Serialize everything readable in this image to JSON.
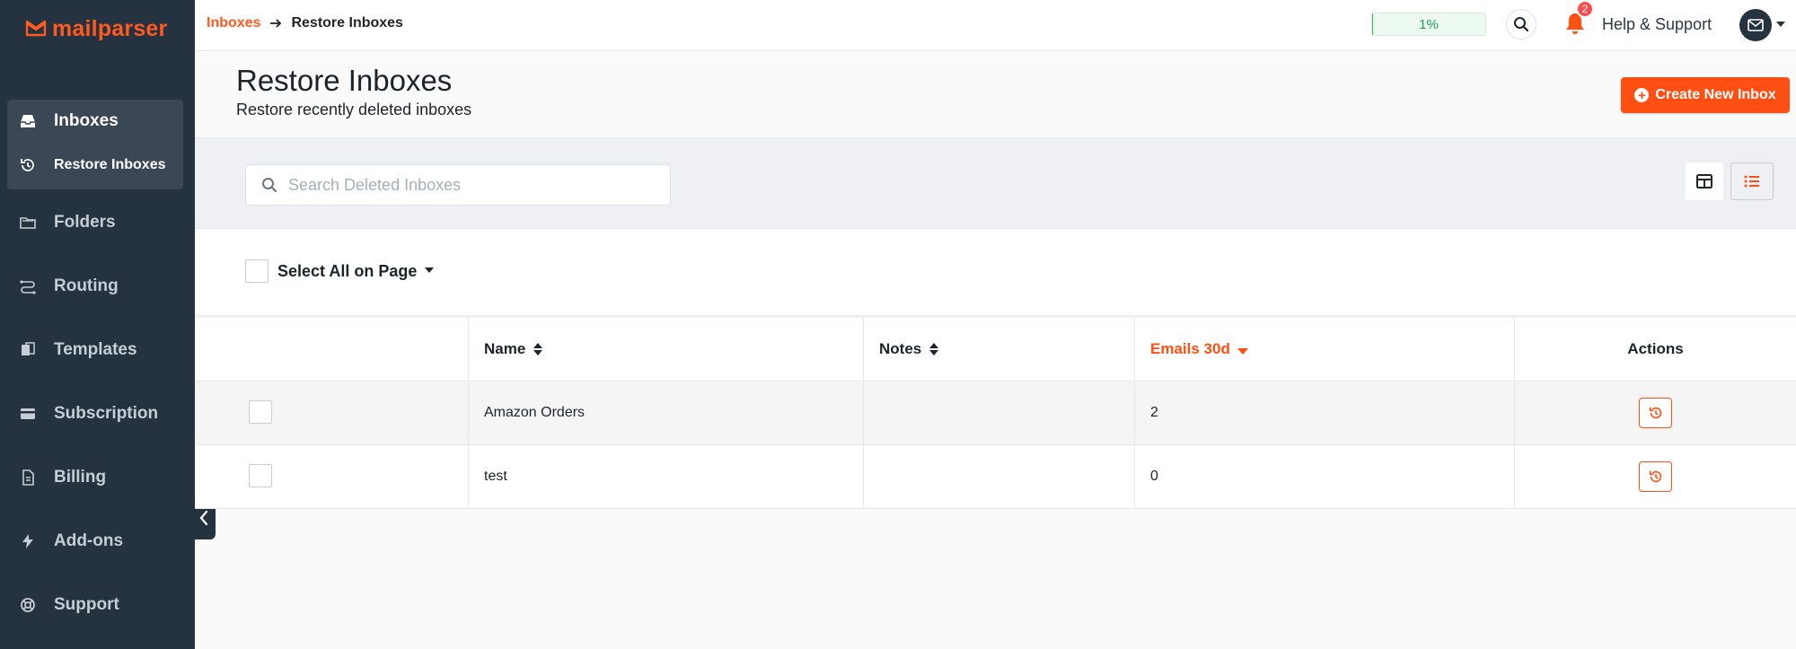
{
  "app": {
    "logo_text": "mailparser",
    "brand_color": "#ff5a1f"
  },
  "breadcrumb": {
    "parent": "Inboxes",
    "current": "Restore Inboxes"
  },
  "topbar": {
    "usage_percent": 1,
    "usage_label": "1%",
    "notification_count": "2",
    "help_label": "Help & Support"
  },
  "sidebar": {
    "items": [
      {
        "label": "Inboxes",
        "icon": "inbox-icon"
      },
      {
        "label": "Restore Inboxes",
        "icon": "history-icon"
      },
      {
        "label": "Folders",
        "icon": "folders-icon"
      },
      {
        "label": "Routing",
        "icon": "routing-icon"
      },
      {
        "label": "Templates",
        "icon": "templates-icon"
      },
      {
        "label": "Subscription",
        "icon": "credit-card-icon"
      },
      {
        "label": "Billing",
        "icon": "billing-icon"
      },
      {
        "label": "Add-ons",
        "icon": "bolt-icon"
      },
      {
        "label": "Support",
        "icon": "lifebuoy-icon"
      }
    ]
  },
  "page": {
    "title": "Restore Inboxes",
    "subtitle": "Restore recently deleted inboxes",
    "create_button": "Create New Inbox"
  },
  "search": {
    "placeholder": "Search Deleted Inboxes",
    "value": ""
  },
  "select_all": {
    "label": "Select All on Page"
  },
  "table": {
    "columns": [
      "",
      "Name",
      "Notes",
      "Emails 30d",
      "Actions"
    ],
    "rows": [
      {
        "name": "Amazon Orders",
        "notes": "",
        "emails_30d": "2"
      },
      {
        "name": "test",
        "notes": "",
        "emails_30d": "0"
      }
    ]
  }
}
